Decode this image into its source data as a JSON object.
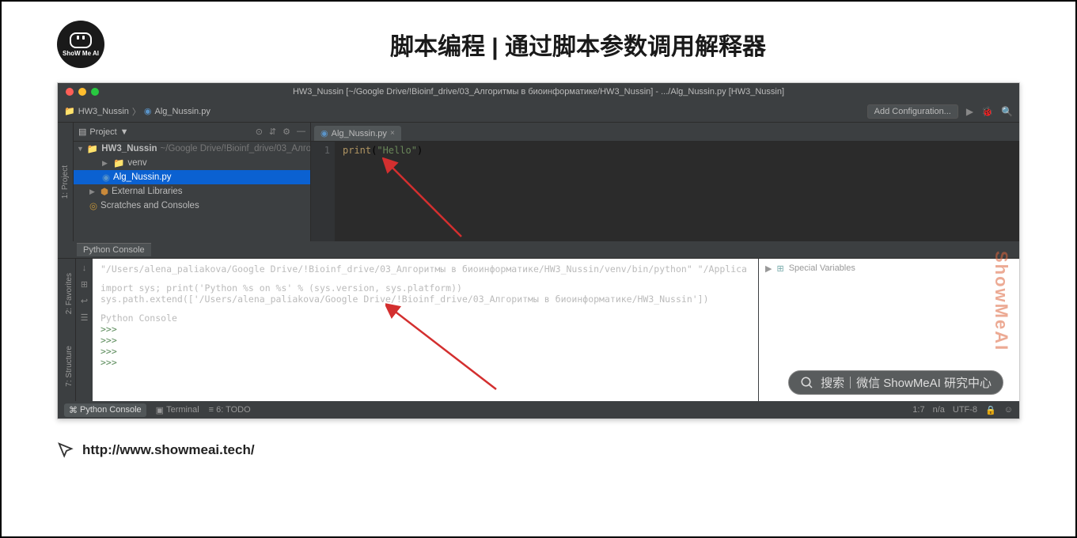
{
  "header": {
    "logo_text": "ShoW Me AI",
    "title": "脚本编程 | 通过脚本参数调用解释器"
  },
  "ide": {
    "titlebar": "HW3_Nussin [~/Google Drive/!Bioinf_drive/03_Алгоритмы в биоинформатике/HW3_Nussin] - .../Alg_Nussin.py [HW3_Nussin]",
    "breadcrumb": {
      "project": "HW3_Nussin",
      "sep": "〉",
      "file": "Alg_Nussin.py"
    },
    "nav": {
      "add_config": "Add Configuration..."
    },
    "project_panel": {
      "title": "Project",
      "dropdown": "▼"
    },
    "tree": {
      "root_name": "HW3_Nussin",
      "root_path": "~/Google Drive/!Bioinf_drive/03_Алгор",
      "items": {
        "venv": "venv",
        "file": "Alg_Nussin.py",
        "ext": "External Libraries",
        "scratch": "Scratches and Consoles"
      }
    },
    "editor": {
      "tab": "Alg_Nussin.py",
      "gutter_line": "1",
      "code": {
        "kw": "print",
        "str": "\"Hello\""
      }
    },
    "vert_tabs": {
      "project": "1: Project",
      "fav": "2: Favorites",
      "struct": "7: Structure"
    },
    "console": {
      "header": "Python Console",
      "line1": "\"/Users/alena_paliakova/Google Drive/!Bioinf_drive/03_Алгоритмы в биоинформатике/HW3_Nussin/venv/bin/python\" \"/Applica",
      "line2": "import sys; print('Python %s on %s' % (sys.version, sys.platform))",
      "line3": "sys.path.extend(['/Users/alena_paliakova/Google Drive/!Bioinf_drive/03_Алгоритмы в биоинформатике/HW3_Nussin'])",
      "line4": "Python Console",
      "prompt": ">>>",
      "right_panel": "Special Variables"
    },
    "statusbar": {
      "python_console": "Python Console",
      "terminal": "Terminal",
      "todo": "6: TODO",
      "pos": "1:7",
      "na": "n/a",
      "enc": "UTF-8"
    }
  },
  "watermark": {
    "side": "ShowMeAI",
    "search": "搜索｜微信 ShowMeAI 研究中心"
  },
  "footer": {
    "url": "http://www.showmeai.tech/"
  }
}
